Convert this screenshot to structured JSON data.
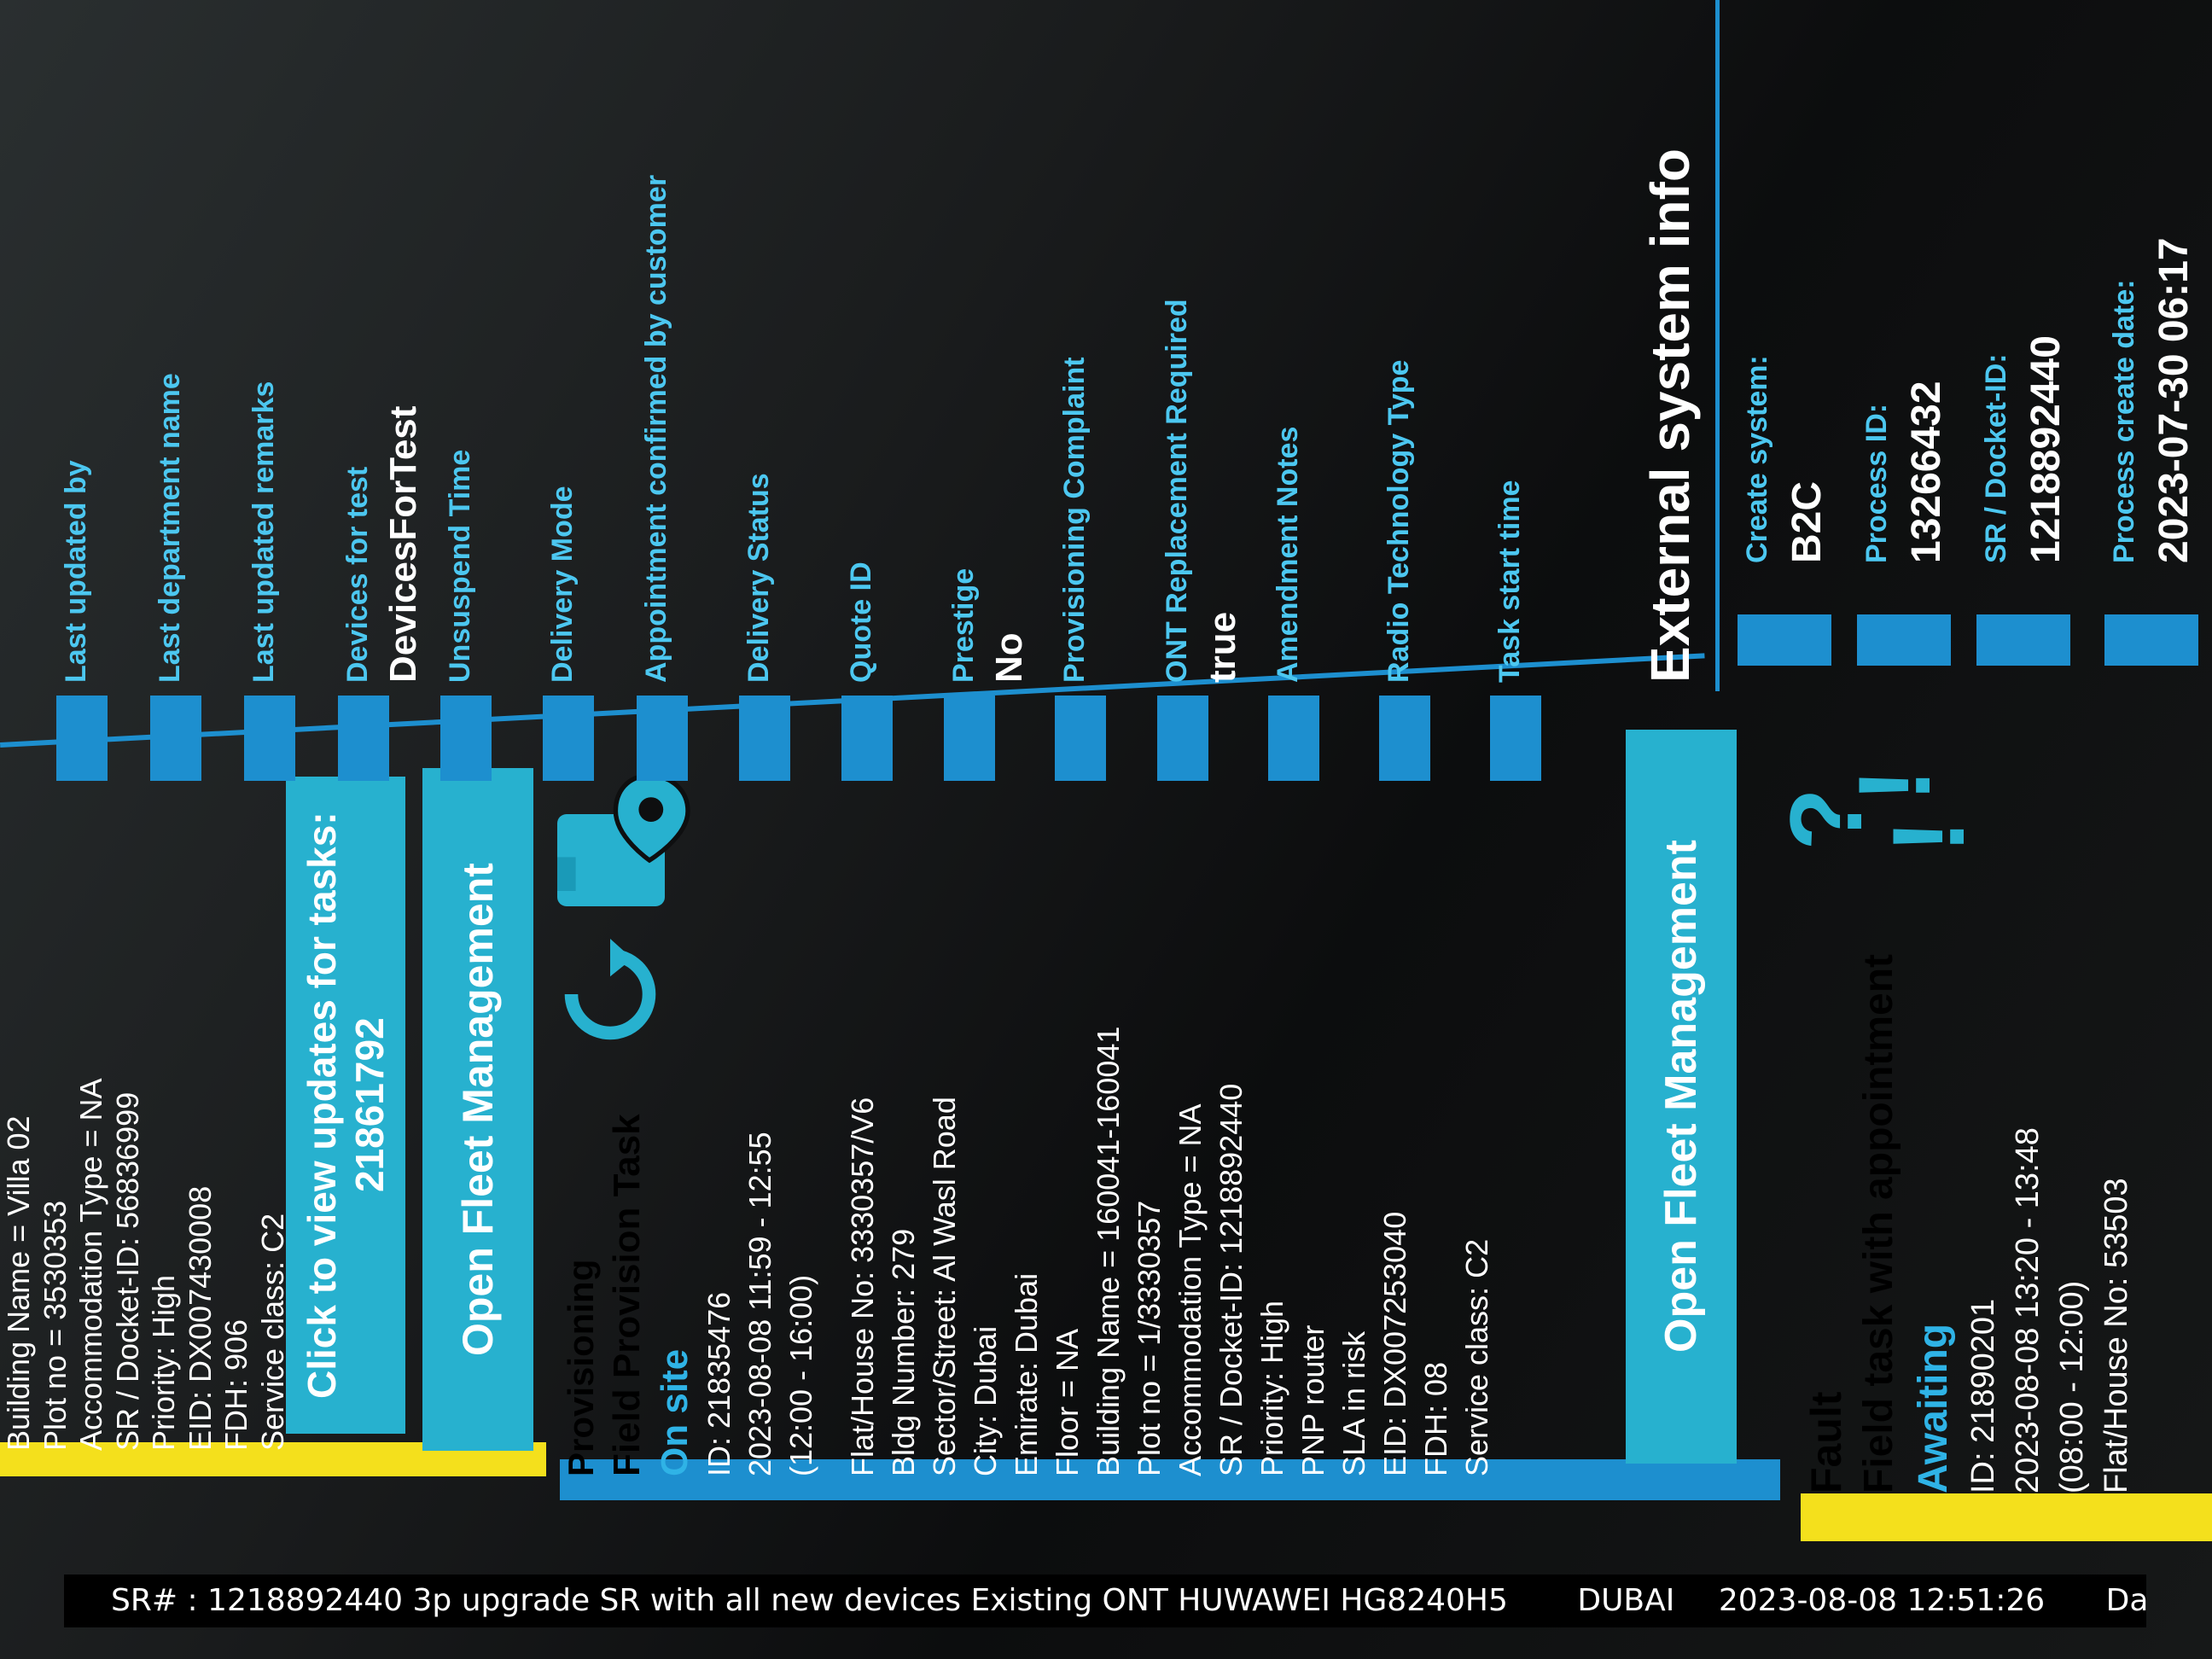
{
  "colors": {
    "accent": "#27b1cf",
    "status_blue": "#2fb3e6",
    "bar_blue": "#1d8fcf",
    "priority_yellow": "#f4e01c",
    "label_cyan": "#4cc7f0"
  },
  "top_card": {
    "rows": [
      "Building Name = Villa 02",
      "Plot no = 3530353",
      "Accommodation Type = NA",
      "SR / Docket-ID: 56836999",
      "Priority: High",
      "EID: DX007430008",
      "FDH: 906",
      "Service class: C2"
    ],
    "view_updates_button": "Click to view updates for tasks: 21861792",
    "fleet_button": "Open Fleet Management"
  },
  "provisioning_card": {
    "category": "Provisioning",
    "task_name": "Field Provision Task",
    "status": "On site",
    "rows": [
      "ID: 21835476",
      "2023-08-08 11:59 - 12:55",
      "(12:00 - 16:00)",
      "",
      "Flat/House No: 3330357/V6",
      "Bldg Number: 279",
      "Sector/Street: Al Wasl Road",
      "City: Dubai",
      "Emirate: Dubai",
      "Floor = NA",
      "Building Name = 160041-160041",
      "Plot no = 1/3330357",
      "Accommodation Type = NA",
      "SR / Docket-ID: 1218892440",
      "Priority: High",
      "PNP router",
      "SLA in risk",
      "EID: DX007253040",
      "FDH: 08",
      "Service class: C2"
    ],
    "fleet_button": "Open Fleet Management",
    "icons": [
      "refresh-icon",
      "map-pin-folder-icon"
    ]
  },
  "fault_card": {
    "category": "Fault",
    "task_name": "Field task with appointment",
    "status": "Awaiting",
    "rows": [
      "ID: 21890201",
      "2023-08-08 13:20 - 13:48",
      "(08:00 - 12:00)",
      "Flat/House No: 53503"
    ],
    "icons": [
      "question-mark-icon",
      "exclamation-icon"
    ]
  },
  "info_fields": [
    {
      "label": "Last updated by",
      "value": ""
    },
    {
      "label": "Last department name",
      "value": ""
    },
    {
      "label": "Last updated remarks",
      "value": ""
    },
    {
      "label": "Devices for test",
      "value": "DevicesForTest"
    },
    {
      "label": "Unsuspend Time",
      "value": ""
    },
    {
      "label": "Delivery Mode",
      "value": ""
    },
    {
      "label": "Appointment confirmed by customer",
      "value": ""
    },
    {
      "label": "Delivery Status",
      "value": ""
    },
    {
      "label": "Quote ID",
      "value": ""
    },
    {
      "label": "Prestige",
      "value": "No"
    },
    {
      "label": "Provisioning Complaint",
      "value": ""
    },
    {
      "label": "ONT Replacement Required",
      "value": "true"
    },
    {
      "label": "Amendment Notes",
      "value": ""
    },
    {
      "label": "Radio Technology Type",
      "value": ""
    },
    {
      "label": "Task start time",
      "value": ""
    }
  ],
  "external_system": {
    "heading": "External system info",
    "fields": [
      {
        "label": "Create system:",
        "value": "B2C"
      },
      {
        "label": "Process ID:",
        "value": "13266432"
      },
      {
        "label": "SR / Docket-ID:",
        "value": "1218892440"
      },
      {
        "label": "Process create date:",
        "value": "2023-07-30 06:17"
      }
    ]
  },
  "watermark": {
    "sr": "SR# : 1218892440 3p upgrade SR with all new devices Existing ONT HUWAWEI HG8240H5",
    "city": "DUBAI",
    "datetime": "2023-08-08 12:51:26",
    "trailing": "Date"
  }
}
